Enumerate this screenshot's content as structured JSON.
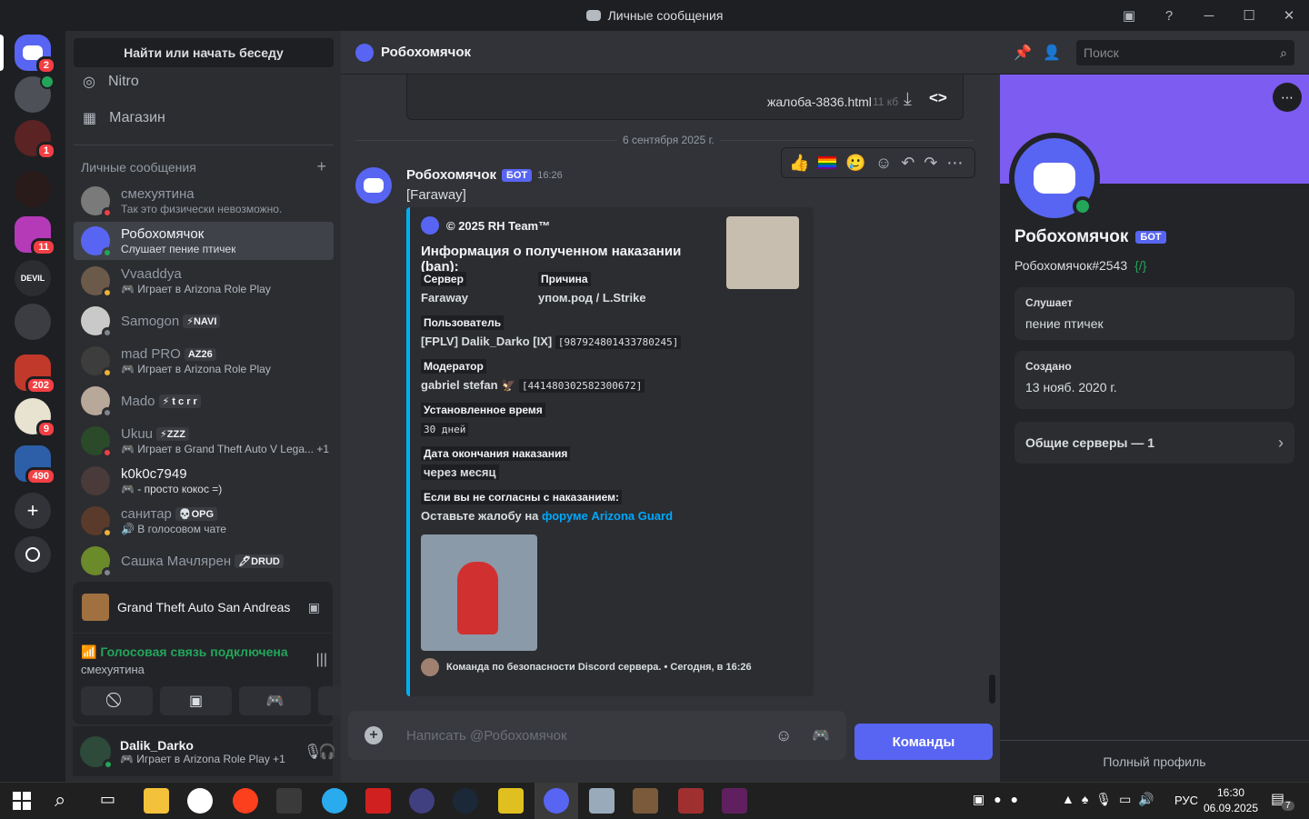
{
  "window": {
    "title": "Личные сообщения"
  },
  "guilds": {
    "badges": [
      "2",
      "1",
      "11",
      "202",
      "9",
      "490"
    ]
  },
  "dmlist": {
    "find_label": "Найти или начать беседу",
    "nitro": "Nitro",
    "shop": "Магазин",
    "header": "Личные сообщения",
    "add": "+",
    "items": [
      {
        "name": "смехуятина",
        "sub": "Так это физически невозможно."
      },
      {
        "name": "Робохомячок",
        "sub": "Слушает пение птичек"
      },
      {
        "name": "Vvaaddya",
        "sub": "Играет в Arizona Role Play"
      },
      {
        "name": "Samogon",
        "tag": "⚡NAVI",
        "sub": ""
      },
      {
        "name": "mad PRO",
        "tag": "AZ26",
        "sub": "Играет в Arizona Role Play"
      },
      {
        "name": "Mado",
        "tag": "⚡ t c r r",
        "sub": ""
      },
      {
        "name": "Ukuu",
        "tag": "⚡ZZZ",
        "sub": "Играет в Grand Theft Auto V Lega... +1"
      },
      {
        "name": "k0k0c7949",
        "sub": "- просто кокос =)"
      },
      {
        "name": "санитар",
        "tag": "💀OPG",
        "sub": "В голосовом чате"
      },
      {
        "name": "Сашка Мачлярен",
        "tag": "🖊DRUD",
        "sub": ""
      }
    ]
  },
  "game_panel": {
    "title": "Grand Theft Auto San Andreas"
  },
  "voice_panel": {
    "status": "Голосовая связь подключена",
    "channel": "смехуятина"
  },
  "user_panel": {
    "name": "Dalik_Darko",
    "status": "Играет в Arizona Role Play +1"
  },
  "chat": {
    "header_name": "Робохомячок",
    "search_placeholder": "Поиск",
    "attachment": {
      "name": "жалоба-3836.html",
      "size": "11 кб"
    },
    "date_divider": "6 сентября 2025 г.",
    "message": {
      "author": "Робохомячок",
      "bot_tag": "БОТ",
      "time": "16:26",
      "text": "[Faraway]"
    },
    "embed": {
      "author": "© 2025 RH Team™",
      "title": "Информация о полученном наказании (ban):",
      "fields": {
        "server_label": "Сервер",
        "server_value": "Faraway",
        "reason_label": "Причина",
        "reason_value": "упом.род / L.Strike",
        "user_label": "Пользователь",
        "user_value": "[FPLV] Dalik_Darko [IX]",
        "user_id": "[987924801433780245]",
        "mod_label": "Модератор",
        "mod_value": "gabriel stefan",
        "mod_id": "[441480302582300672]",
        "duration_label": "Установленное время",
        "duration_value": "30 дней",
        "end_label": "Дата окончания наказания",
        "end_value": "через месяц",
        "appeal_label": "Если вы не согласны с наказанием:",
        "appeal_prefix": "Оставьте жалобу на",
        "appeal_link": "форуме Arizona Guard"
      },
      "footer": "Команда по безопасности Discord сервера. • Сегодня, в 16:26"
    },
    "input_placeholder": "Написать @Робохомячок",
    "commands_button": "Команды"
  },
  "profile": {
    "name": "Робохомячок",
    "bot_tag": "БОТ",
    "tag": "Робохомячок#2543",
    "listening_label": "Слушает",
    "listening_value": "пение птичек",
    "created_label": "Создано",
    "created_value": "13 нояб. 2020 г.",
    "mutual_servers": "Общие серверы — 1",
    "full_profile": "Полный профиль"
  },
  "taskbar": {
    "lang": "РУС",
    "time": "16:30",
    "date": "06.09.2025",
    "notif": "7"
  },
  "colors": {
    "blurple": "#5865f2",
    "online": "#23a55a",
    "dnd": "#f23f43",
    "idle": "#f0b232",
    "banner": "#7d5cf2",
    "link": "#00a8fc"
  }
}
